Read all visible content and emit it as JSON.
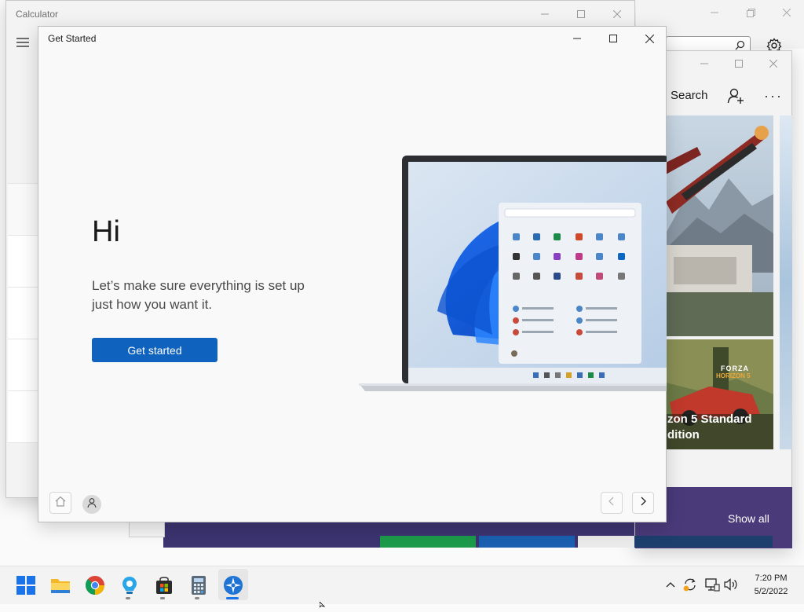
{
  "calculator": {
    "title": "Calculator"
  },
  "get_started": {
    "title": "Get Started",
    "heading": "Hi",
    "subtitle": "Let’s make sure everything is set up just how you want it.",
    "button_label": "Get started"
  },
  "store": {
    "search_label": "Search",
    "game_title_line1": "zon 5 Standard",
    "game_title_line2": "dition",
    "game_logo_line1": "FORZA",
    "game_logo_line2": "HORIZON 5",
    "show_all_label": "Show all"
  },
  "taskbar": {
    "time": "7:20 PM",
    "date": "5/2/2022",
    "apps": [
      "start-icon",
      "file-explorer-icon",
      "chrome-icon",
      "cortana-icon",
      "microsoft-store-icon",
      "calculator-icon",
      "get-started-icon"
    ]
  },
  "colors": {
    "accent": "#0f62be",
    "store_banner": "#4a3a7a",
    "taskbar": "#f3f3f3"
  }
}
